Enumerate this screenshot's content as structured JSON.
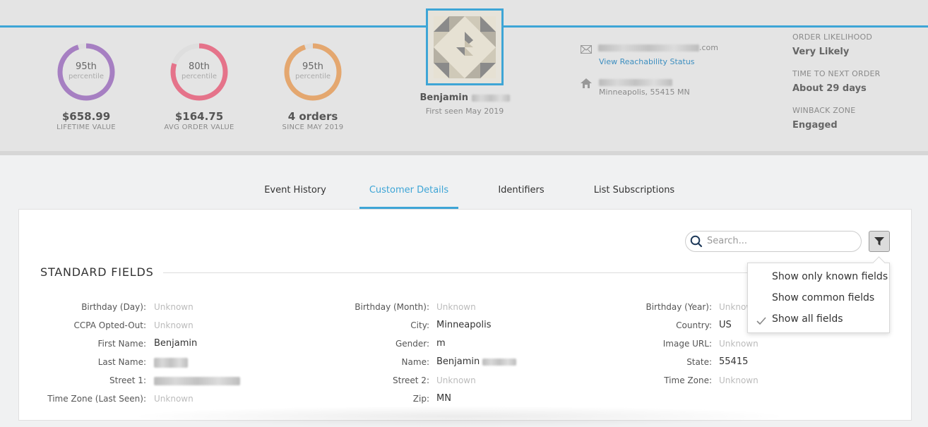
{
  "stats": [
    {
      "pct": "95th",
      "sub": "percentile",
      "value": "$658.99",
      "label": "LIFETIME VALUE",
      "color": "#a67fc2",
      "fill": 0.95
    },
    {
      "pct": "80th",
      "sub": "percentile",
      "value": "$164.75",
      "label": "AVG ORDER VALUE",
      "color": "#e5738a",
      "fill": 0.8
    },
    {
      "pct": "95th",
      "sub": "percentile",
      "value": "4 orders",
      "label": "SINCE MAY 2019",
      "color": "#e4a76f",
      "fill": 0.95
    }
  ],
  "profile": {
    "first_name": "Benjamin",
    "first_seen": "First seen May 2019"
  },
  "contact": {
    "email_suffix": ".com",
    "reachability_link": "View Reachability Status",
    "location": "Minneapolis, 55415 MN"
  },
  "insights": [
    {
      "label": "ORDER LIKELIHOOD",
      "value": "Very Likely"
    },
    {
      "label": "TIME TO NEXT ORDER",
      "value": "About 29 days"
    },
    {
      "label": "WINBACK ZONE",
      "value": "Engaged"
    }
  ],
  "tabs": [
    "Event History",
    "Customer Details",
    "Identifiers",
    "List Subscriptions"
  ],
  "active_tab": "Customer Details",
  "search": {
    "placeholder": "Search..."
  },
  "section_title": "STANDARD FIELDS",
  "filter_menu": {
    "items": [
      "Show only known fields",
      "Show common fields",
      "Show all fields"
    ],
    "selected": "Show all fields"
  },
  "fields": {
    "col1": [
      {
        "label": "Birthday (Day):",
        "value": "Unknown"
      },
      {
        "label": "CCPA Opted-Out:",
        "value": "Unknown"
      },
      {
        "label": "First Name:",
        "value": "Benjamin"
      },
      {
        "label": "Last Name:",
        "value": ""
      },
      {
        "label": "Street 1:",
        "value": ""
      },
      {
        "label": "Time Zone (Last Seen):",
        "value": "Unknown"
      }
    ],
    "col2": [
      {
        "label": "Birthday (Month):",
        "value": "Unknown"
      },
      {
        "label": "City:",
        "value": "Minneapolis"
      },
      {
        "label": "Gender:",
        "value": "m"
      },
      {
        "label": "Name:",
        "value": "Benjamin"
      },
      {
        "label": "Street 2:",
        "value": "Unknown"
      },
      {
        "label": "Zip:",
        "value": "MN"
      }
    ],
    "col3": [
      {
        "label": "Birthday (Year):",
        "value": "Unknown"
      },
      {
        "label": "Country:",
        "value": "US"
      },
      {
        "label": "Image URL:",
        "value": "Unknown"
      },
      {
        "label": "State:",
        "value": "55415"
      },
      {
        "label": "Time Zone:",
        "value": "Unknown"
      }
    ]
  }
}
